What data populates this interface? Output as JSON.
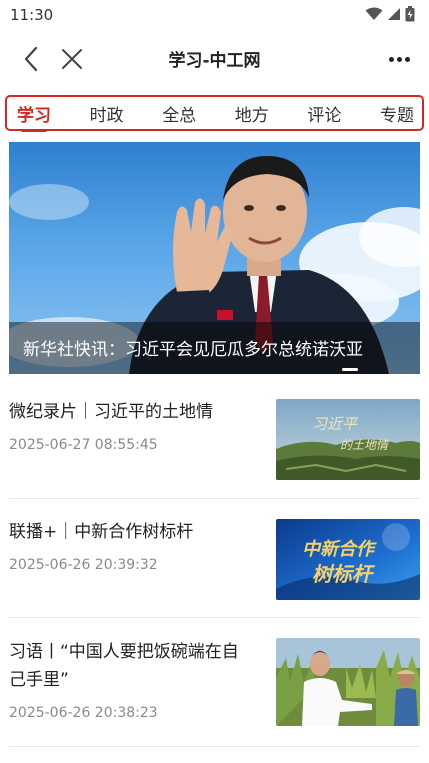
{
  "status_bar": {
    "time": "11:30"
  },
  "nav": {
    "title": "学习-中工网",
    "back_icon": "chevron-left-icon",
    "close_icon": "close-icon",
    "more_icon": "more-dots-icon"
  },
  "tabs": [
    {
      "label": "学习",
      "active": true
    },
    {
      "label": "时政",
      "active": false
    },
    {
      "label": "全总",
      "active": false
    },
    {
      "label": "地方",
      "active": false
    },
    {
      "label": "评论",
      "active": false
    },
    {
      "label": "专题",
      "active": false
    }
  ],
  "colors": {
    "accent": "#d6281e",
    "time_text": "#8a8a8a"
  },
  "hero": {
    "caption": "新华社快讯：习近平会见厄瓜多尔总统诺沃亚"
  },
  "news": [
    {
      "title": "微纪录片｜习近平的土地情",
      "time": "2025-06-27 08:55:45",
      "thumb_text_1": "习近平",
      "thumb_text_2": "的土地情"
    },
    {
      "title": "联播+｜中新合作树标杆",
      "time": "2025-06-26 20:39:32",
      "thumb_text_1": "中新合作",
      "thumb_text_2": "树标杆"
    },
    {
      "title": "习语丨“中国人要把饭碗端在自己手里”",
      "time": "2025-06-26 20:38:23"
    }
  ]
}
